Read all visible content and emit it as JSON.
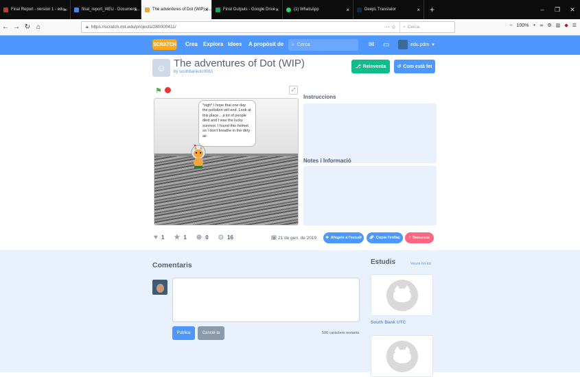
{
  "browser": {
    "tabs": [
      {
        "label": "Final Report - version 1 - edu...",
        "color": "#c0392b"
      },
      {
        "label": "final_report_I4EU - Document...",
        "color": "#4285f4"
      },
      {
        "label": "The adventures of Dot (WIP) o...",
        "color": "#f5a623"
      },
      {
        "label": "Final Outputs - Google Drive",
        "color": "#1fa463"
      },
      {
        "label": "(1) WhatsApp",
        "color": "#25d366"
      },
      {
        "label": "DeepL Translator",
        "color": "#0f2b46"
      }
    ],
    "url": "https://scratch.mit.edu/projects/280000411/",
    "search_placeholder": "Cerca",
    "zoom": "100%"
  },
  "scratch_nav": {
    "logo": "SCRATCH",
    "items": [
      "Crea",
      "Explora",
      "Idees",
      "A propòsit de"
    ],
    "search_placeholder": "Cerca",
    "username": "edu.pdm"
  },
  "project": {
    "title": "The adventures of Dot (WIP)",
    "author": "by southbankutc0063",
    "remix_label": "Reinventa",
    "see_inside_label": "Com està fet",
    "speech": "*sigh* I hope that one day the pollution will end. Look at this place... a lot of people died and I was the lucky survivor. I found this helmet so I don't breathe in the dirty air.",
    "instructions_label": "Instruccions",
    "notes_label": "Notes i Informació",
    "stats": {
      "loves": "1",
      "favorites": "1",
      "remixes": "0",
      "views": "16"
    },
    "date": "21 de gen. de 2019",
    "add_to_studio": "Afegeix a l'estudi",
    "copy_link": "Copia l'enllaç",
    "report": "Denuncia"
  },
  "comments": {
    "title": "Comentaris",
    "publish": "Publica",
    "cancel": "Cancel·la",
    "chars_left": "500 caràcters restants"
  },
  "studios": {
    "title": "Estudis",
    "see_all": "Veure-ho tot",
    "items": [
      {
        "name": "South Bank UTC"
      },
      {
        "name": ""
      }
    ]
  }
}
